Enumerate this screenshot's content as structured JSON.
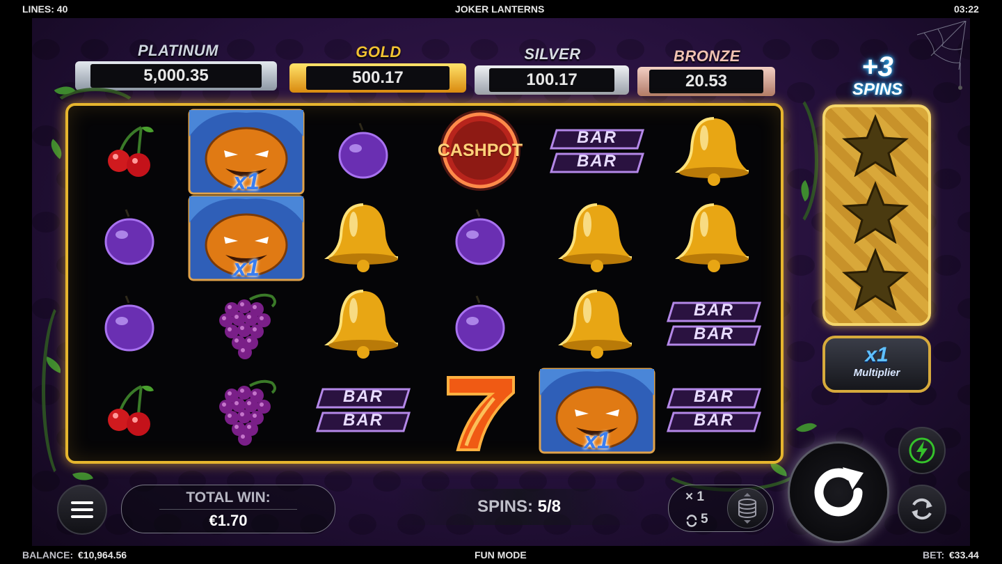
{
  "topbar": {
    "lines": "LINES: 40",
    "game_title": "JOKER LANTERNS",
    "clock": "03:22"
  },
  "bottombar": {
    "balance_label": "BALANCE:",
    "balance_value": "€10,964.56",
    "mode": "FUN MODE",
    "bet_label": "BET:",
    "bet_value": "€33.44"
  },
  "jackpots": [
    {
      "label": "PLATINUM",
      "value": "5,000.35",
      "label_color": "#cfd6e0",
      "frame_color": "#b9c3cf"
    },
    {
      "label": "GOLD",
      "value": "500.17",
      "label_color": "#f2c232",
      "frame_color": "#f0b51e"
    },
    {
      "label": "SILVER",
      "value": "100.17",
      "label_color": "#d9dde3",
      "frame_color": "#c9ced6"
    },
    {
      "label": "BRONZE",
      "value": "20.53",
      "label_color": "#f0c2b2",
      "frame_color": "#d9a08e"
    }
  ],
  "reels": [
    [
      "cherry",
      "plum",
      "plum",
      "cherry"
    ],
    [
      "joker",
      "joker",
      "grapes",
      "grapes"
    ],
    [
      "plum",
      "bell",
      "bell",
      "bar"
    ],
    [
      "cashpot",
      "plum",
      "plum",
      "seven"
    ],
    [
      "bar",
      "bell",
      "bell",
      "joker"
    ],
    [
      "bell",
      "bell",
      "bar",
      "bar"
    ]
  ],
  "symbol_text": {
    "cashpot": "CASHPOT",
    "bar": "BAR",
    "joker_multiplier": "x1"
  },
  "bonus": {
    "plus": "+3",
    "spins": "SPINS",
    "stars_count": 3
  },
  "multiplier": {
    "value": "x1",
    "label": "Multiplier"
  },
  "total_win": {
    "label": "TOTAL WIN:",
    "value": "€1.70"
  },
  "spins_status": {
    "label": "SPINS:",
    "value": "5/8"
  },
  "autoplay": {
    "multiplier": "× 1",
    "count": "5"
  },
  "colors": {
    "accent_gold": "#e6b52e",
    "bonus_blue": "#2ab8ff",
    "turbo_green": "#35c22b"
  }
}
